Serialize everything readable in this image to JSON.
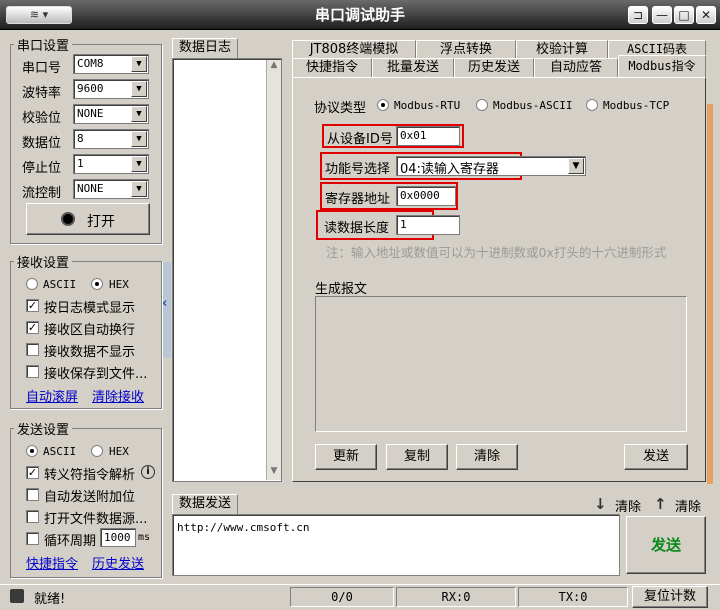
{
  "window": {
    "title": "串口调试助手",
    "sysmenu": "≋",
    "pin": "⊐",
    "min": "—",
    "max": "□",
    "close": "✕"
  },
  "serial": {
    "group": "串口设置",
    "rows": [
      {
        "label": "串口号",
        "value": "COM8"
      },
      {
        "label": "波特率",
        "value": "9600"
      },
      {
        "label": "校验位",
        "value": "NONE"
      },
      {
        "label": "数据位",
        "value": "8"
      },
      {
        "label": "停止位",
        "value": "1"
      },
      {
        "label": "流控制",
        "value": "NONE"
      }
    ],
    "open": "打开"
  },
  "recv": {
    "group": "接收设置",
    "ascii": "ASCII",
    "hex": "HEX",
    "opts": [
      "按日志模式显示",
      "接收区自动换行",
      "接收数据不显示",
      "接收保存到文件..."
    ],
    "links": [
      "自动滚屏",
      "清除接收"
    ]
  },
  "send": {
    "group": "发送设置",
    "ascii": "ASCII",
    "hex": "HEX",
    "opts": [
      "转义符指令解析",
      "自动发送附加位",
      "打开文件数据源...",
      "循环周期"
    ],
    "period": "1000",
    "unit": "ms",
    "info": "i",
    "links": [
      "快捷指令",
      "历史发送"
    ]
  },
  "log": {
    "tab": "数据日志"
  },
  "tabs": {
    "row1": [
      "JT808终端模拟",
      "浮点转换",
      "校验计算",
      "ASCII码表"
    ],
    "row2": [
      "快捷指令",
      "批量发送",
      "历史发送",
      "自动应答",
      "Modbus指令"
    ]
  },
  "modbus": {
    "proto_label": "协议类型",
    "protos": [
      "Modbus-RTU",
      "Modbus-ASCII",
      "Modbus-TCP"
    ],
    "slave_label": "从设备ID号",
    "slave": "0x01",
    "func_label": "功能号选择",
    "func": "04:读输入寄存器",
    "reg_label": "寄存器地址",
    "reg": "0x0000",
    "len_label": "读数据长度",
    "len": "1",
    "note": "注：输入地址或数值可以为十进制数或0x打头的十六进制形式",
    "gen_label": "生成报文",
    "buttons": [
      "更新",
      "复制",
      "清除"
    ],
    "send": "发送"
  },
  "datasend": {
    "tab": "数据发送",
    "clear1": "清除",
    "clear2": "清除",
    "text": "http://www.cmsoft.cn",
    "send": "发送"
  },
  "status": {
    "ready": "就绪!",
    "count": "0/0",
    "rx": "RX:0",
    "tx": "TX:0",
    "reset": "复位计数"
  }
}
